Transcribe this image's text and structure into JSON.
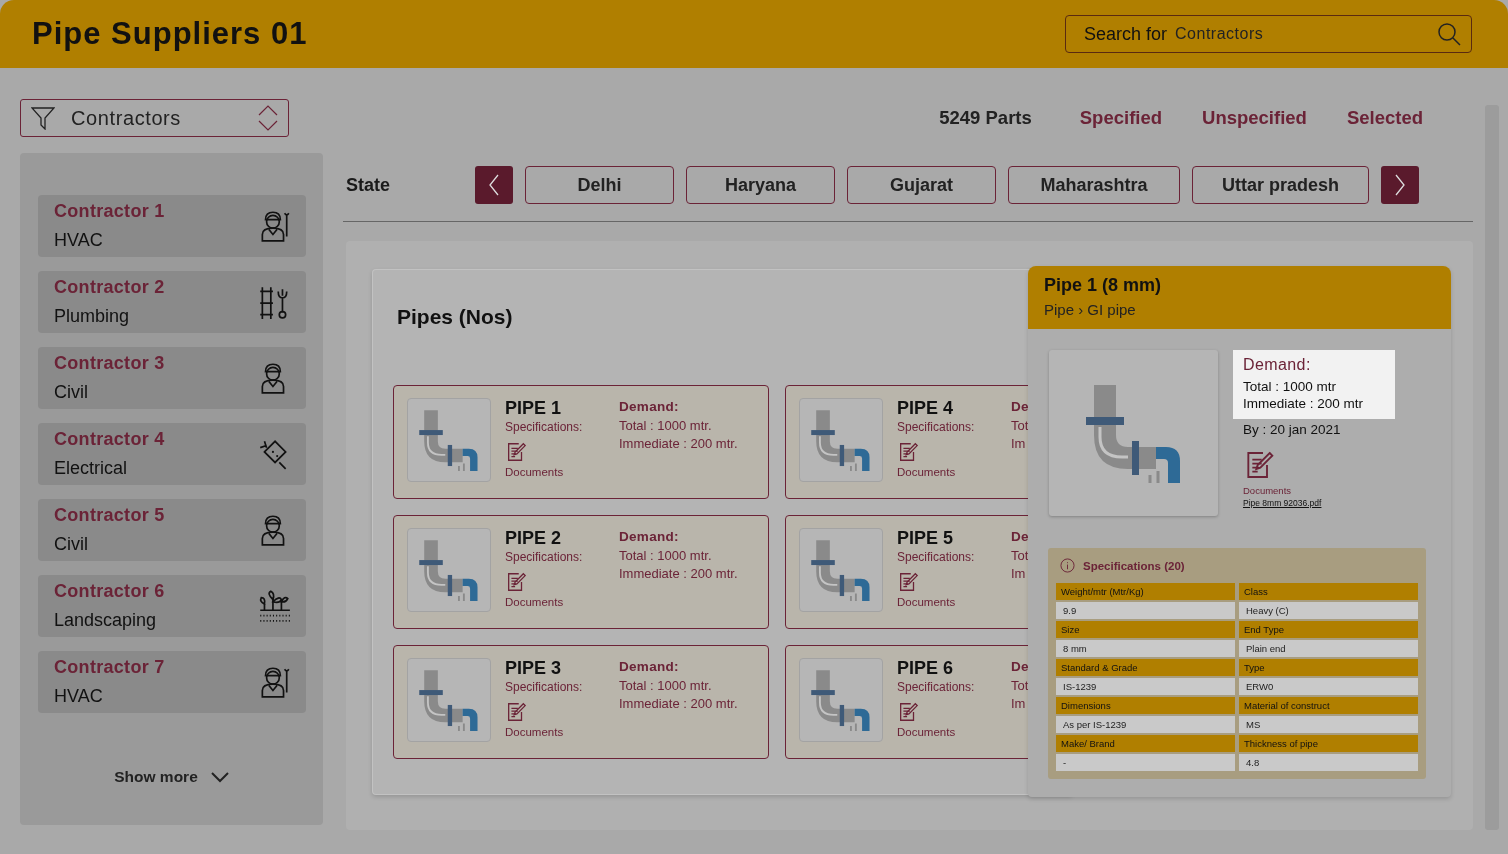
{
  "header": {
    "title": "Pipe Suppliers 01",
    "search": {
      "label": "Search for",
      "placeholder": "Contractors"
    }
  },
  "filter": {
    "value": "Contractors"
  },
  "summary": {
    "count": "5249 Parts",
    "filters": [
      {
        "label": "Specified"
      },
      {
        "label": "Unspecified"
      },
      {
        "label": "Selected"
      }
    ]
  },
  "contractors": [
    {
      "name": "Contractor 1",
      "trade": "HVAC",
      "kind": "hvac"
    },
    {
      "name": "Contractor 2",
      "trade": "Plumbing",
      "kind": "plumbing"
    },
    {
      "name": "Contractor 3",
      "trade": "Civil",
      "kind": "civil"
    },
    {
      "name": "Contractor 4",
      "trade": "Electrical",
      "kind": "electrical"
    },
    {
      "name": "Contractor 5",
      "trade": "Civil",
      "kind": "civil"
    },
    {
      "name": "Contractor 6",
      "trade": "Landscaping",
      "kind": "landscaping"
    },
    {
      "name": "Contractor 7",
      "trade": "HVAC",
      "kind": "hvac"
    }
  ],
  "show_more": "Show more",
  "state_filter": {
    "label": "State",
    "states": [
      {
        "label": "Delhi"
      },
      {
        "label": "Haryana"
      },
      {
        "label": "Gujarat"
      },
      {
        "label": "Maharashtra"
      },
      {
        "label": "Uttar pradesh"
      }
    ]
  },
  "pipes_panel": {
    "title": "Pipes (Nos)",
    "pipes": [
      {
        "name": "PIPE 1",
        "specs_label": "Specifications:",
        "docs_label": "Documents",
        "demand_label": "Demand:",
        "total": "Total : 1000 mtr.",
        "immediate": "Immediate : 200 mtr."
      },
      {
        "name": "PIPE 4",
        "specs_label": "Specifications:",
        "docs_label": "Documents",
        "demand_label": "De",
        "total": "Tot",
        "immediate": "Im"
      },
      {
        "name": "PIPE 2",
        "specs_label": "Specifications:",
        "docs_label": "Documents",
        "demand_label": "Demand:",
        "total": "Total : 1000 mtr.",
        "immediate": "Immediate : 200 mtr."
      },
      {
        "name": "PIPE 5",
        "specs_label": "Specifications:",
        "docs_label": "Documents",
        "demand_label": "De",
        "total": "Tot",
        "immediate": "Im"
      },
      {
        "name": "PIPE 3",
        "specs_label": "Specifications:",
        "docs_label": "Documents",
        "demand_label": "Demand:",
        "total": "Total : 1000 mtr.",
        "immediate": "Immediate : 200 mtr."
      },
      {
        "name": "PIPE 6",
        "specs_label": "Specifications:",
        "docs_label": "Documents",
        "demand_label": "De",
        "total": "Tot",
        "immediate": "Im"
      }
    ]
  },
  "detail": {
    "title": "Pipe 1 (8 mm)",
    "breadcrumb": "Pipe › GI pipe",
    "demand": {
      "label": "Demand:",
      "total": "Total : 1000 mtr",
      "immediate": "Immediate : 200 mtr"
    },
    "by": "By : 20 jan 2021",
    "documents": {
      "label": "Documents",
      "file": "Pipe 8mm 92036.pdf"
    },
    "specs": {
      "title": "Specifications (20)",
      "rows": [
        [
          {
            "name": "Weight/mtr (Mtr/Kg)",
            "value": "9.9"
          },
          {
            "name": "Class",
            "value": "Heavy (C)"
          }
        ],
        [
          {
            "name": "Size",
            "value": "8 mm"
          },
          {
            "name": "End Type",
            "value": "Plain end"
          }
        ],
        [
          {
            "name": "Standard & Grade",
            "value": "IS-1239"
          },
          {
            "name": "Type",
            "value": "ERW0"
          }
        ],
        [
          {
            "name": "Dimensions",
            "value": "As per IS-1239"
          },
          {
            "name": "Material of construct",
            "value": "MS"
          }
        ],
        [
          {
            "name": "Make/ Brand",
            "value": "-"
          },
          {
            "name": "Thickness of pipe",
            "value": "4.8"
          }
        ]
      ]
    }
  }
}
